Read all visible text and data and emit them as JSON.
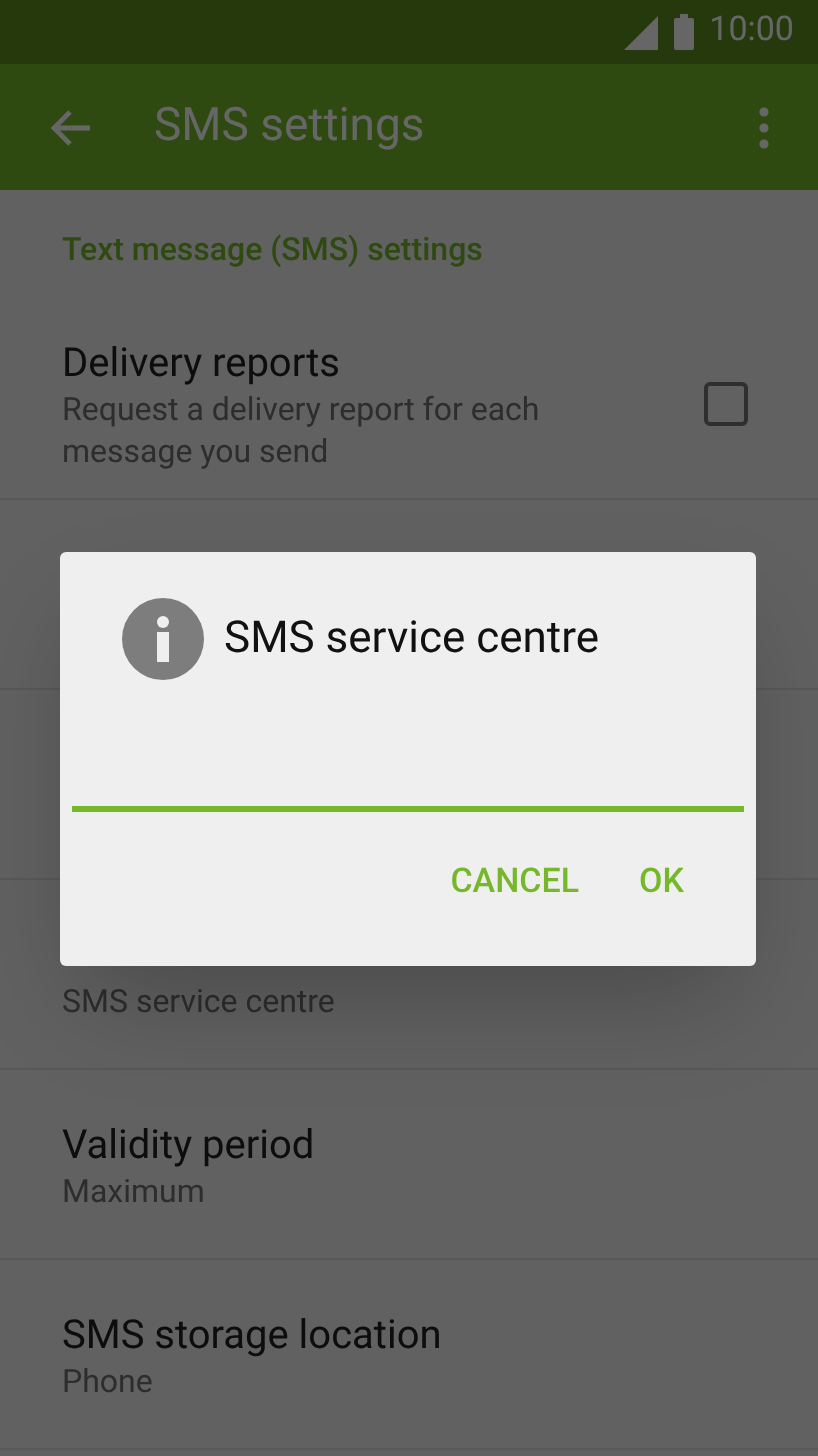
{
  "status_bar": {
    "time": "10:00"
  },
  "app_bar": {
    "title": "SMS settings"
  },
  "section_header": "Text message (SMS) settings",
  "settings": [
    {
      "kind": "checkbox",
      "title": "Delivery reports",
      "summary": "Request a delivery report for each message you send",
      "checked": false
    },
    {
      "kind": "value",
      "summary": "SMS service centre"
    },
    {
      "kind": "value",
      "title": "Validity period",
      "summary": "Maximum"
    },
    {
      "kind": "value",
      "title": "SMS storage location",
      "summary": "Phone"
    }
  ],
  "dialog": {
    "title": "SMS service centre",
    "buttons": [
      "CANCEL",
      "OK"
    ]
  }
}
